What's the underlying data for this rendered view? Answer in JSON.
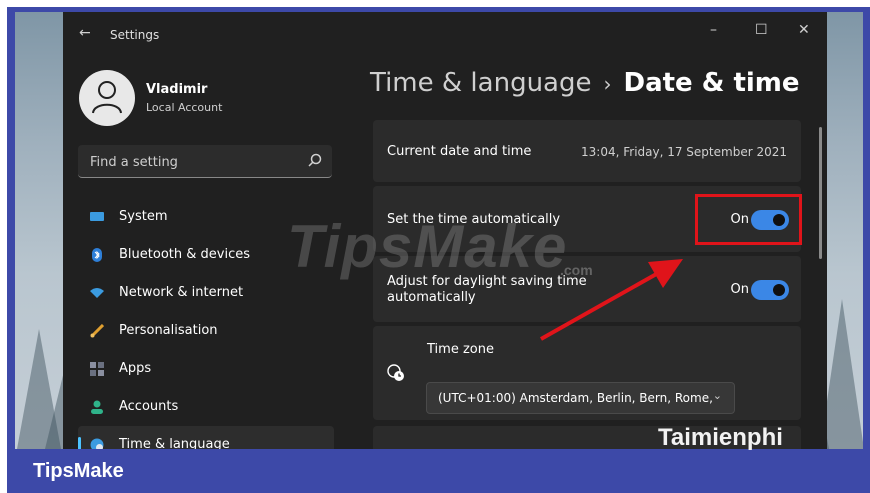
{
  "window": {
    "back_glyph": "←",
    "title": "Settings",
    "controls": {
      "minimize": "–",
      "maximize": "☐",
      "close": "✕"
    }
  },
  "profile": {
    "name": "Vladimir",
    "account_type": "Local Account"
  },
  "search": {
    "placeholder": "Find a setting"
  },
  "sidebar": {
    "items": [
      {
        "label": "System",
        "icon": "monitor-icon",
        "color": "#3b9be0"
      },
      {
        "label": "Bluetooth & devices",
        "icon": "bluetooth-icon",
        "color": "#2e7fd8"
      },
      {
        "label": "Network & internet",
        "icon": "wifi-icon",
        "color": "#3b9be0"
      },
      {
        "label": "Personalisation",
        "icon": "brush-icon",
        "color": "#e0a030"
      },
      {
        "label": "Apps",
        "icon": "apps-icon",
        "color": "#8a8fa0"
      },
      {
        "label": "Accounts",
        "icon": "person-icon",
        "color": "#2fb38a"
      },
      {
        "label": "Time & language",
        "icon": "globe-clock-icon",
        "color": "#3b9be0",
        "active": true
      }
    ]
  },
  "breadcrumb": {
    "parent": "Time & language",
    "separator": "›",
    "current": "Date & time"
  },
  "main": {
    "current_datetime": {
      "label": "Current date and time",
      "value": "13:04, Friday, 17 September 2021"
    },
    "set_time_auto": {
      "label": "Set the time automatically",
      "state": "On",
      "on": true
    },
    "daylight_saving": {
      "label": "Adjust for daylight saving time automatically",
      "state": "On",
      "on": true
    },
    "time_zone": {
      "label": "Time zone",
      "value": "(UTC+01:00) Amsterdam, Berlin, Bern, Rome,",
      "icon": "globe-clock-icon"
    }
  },
  "colors": {
    "accent": "#3b87e6",
    "highlight": "#e0141a",
    "window_bg": "#202020",
    "card_bg": "#2b2b2b",
    "banner": "#3d49a8"
  },
  "watermarks": {
    "tipsmake": "TipsMake",
    "tipsmake_suffix": ".com",
    "taimienphi": "Taimienphi"
  },
  "banner": {
    "brand": "TipsMake"
  }
}
